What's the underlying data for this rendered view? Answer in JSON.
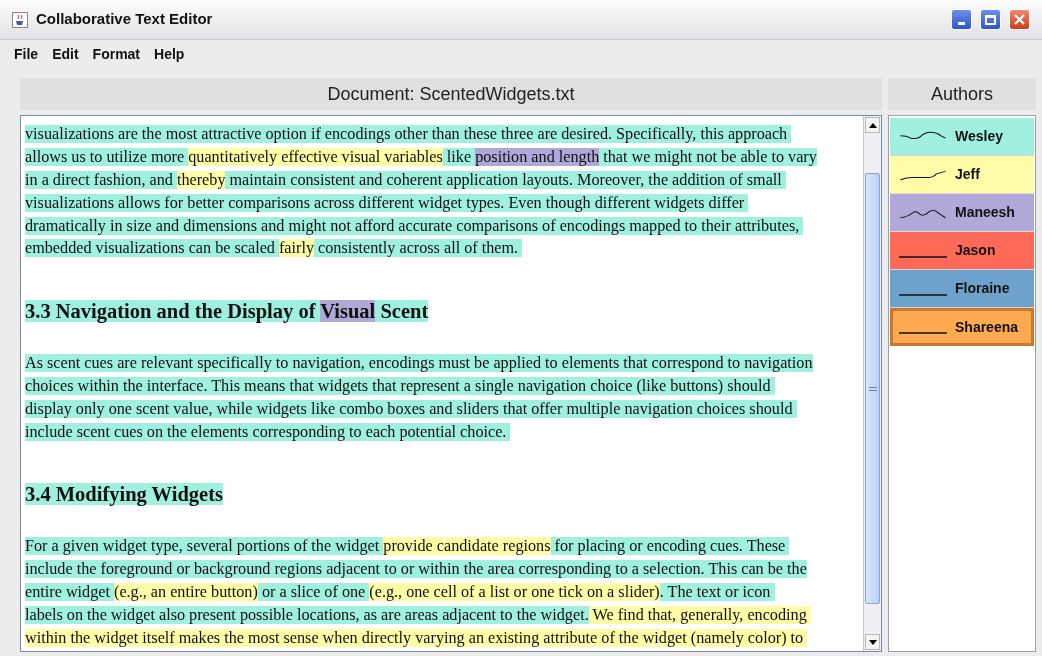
{
  "window": {
    "title": "Collaborative Text Editor"
  },
  "menu": [
    {
      "label": "File"
    },
    {
      "label": "Edit"
    },
    {
      "label": "Format"
    },
    {
      "label": "Help"
    }
  ],
  "document": {
    "title": "Document: ScentedWidgets.txt",
    "blocks": [
      {
        "kind": "paragraph",
        "lines": [
          {
            "segments": [
              {
                "text": "visualizations are the most attractive option if encodings other than these three are desired. Specifically, this approach ",
                "color": "#a0f0e0"
              }
            ]
          },
          {
            "segments": [
              {
                "text": "allows us to utilize more ",
                "color": "#a0f0e0"
              },
              {
                "text": "quantitatively effective visual variables",
                "color": "#fffca8"
              },
              {
                "text": " like ",
                "color": "#a0f0e0"
              },
              {
                "text": "position and length",
                "color": "#b0a8d8"
              },
              {
                "text": " that we might not be able to vary",
                "color": "#a0f0e0"
              }
            ]
          },
          {
            "segments": [
              {
                "text": "in a direct fashion, and ",
                "color": "#a0f0e0"
              },
              {
                "text": "thereby",
                "color": "#fffca8"
              },
              {
                "text": " maintain consistent and coherent application layouts. Moreover, the addition of small ",
                "color": "#a0f0e0"
              }
            ]
          },
          {
            "segments": [
              {
                "text": "visualizations allows for better comparisons across different widget types. Even though different widgets differ ",
                "color": "#a0f0e0"
              }
            ]
          },
          {
            "segments": [
              {
                "text": "dramatically in size and dimensions and might not afford accurate comparisons of encodings mapped to their attributes, ",
                "color": "#a0f0e0"
              }
            ]
          },
          {
            "segments": [
              {
                "text": "embedded visualizations can be scaled ",
                "color": "#a0f0e0"
              },
              {
                "text": "fairly",
                "color": "#fffca8"
              },
              {
                "text": " consistently across all of them. ",
                "color": "#a0f0e0"
              }
            ]
          }
        ]
      },
      {
        "kind": "heading",
        "lines": [
          {
            "segments": [
              {
                "text": "3.3 Navigation and the Display of ",
                "color": "#a0f0e0"
              },
              {
                "text": "Visual",
                "color": "#b0a8d8"
              },
              {
                "text": " Scent",
                "color": "#a0f0e0"
              }
            ]
          }
        ]
      },
      {
        "kind": "paragraph",
        "lines": [
          {
            "segments": [
              {
                "text": "As scent cues are relevant specifically to navigation, encodings must be applied to elements that correspond to navigation",
                "color": "#a0f0e0"
              }
            ]
          },
          {
            "segments": [
              {
                "text": "choices within the interface. This means that widgets that represent a single navigation choice (like buttons) should ",
                "color": "#a0f0e0"
              }
            ]
          },
          {
            "segments": [
              {
                "text": "display only one scent value, while widgets like combo boxes and sliders that offer multiple navigation choices should ",
                "color": "#a0f0e0"
              }
            ]
          },
          {
            "segments": [
              {
                "text": "include scent cues on the elements corresponding to each potential choice. ",
                "color": "#a0f0e0"
              }
            ]
          }
        ]
      },
      {
        "kind": "heading",
        "lines": [
          {
            "segments": [
              {
                "text": "3.4 Modifying Widgets",
                "color": "#a0f0e0"
              }
            ]
          }
        ]
      },
      {
        "kind": "paragraph",
        "lines": [
          {
            "segments": [
              {
                "text": "For a given widget type, several portions of the widget ",
                "color": "#a0f0e0"
              },
              {
                "text": "provide candidate regions",
                "color": "#fffca8"
              },
              {
                "text": " for placing or encoding cues. These ",
                "color": "#a0f0e0"
              }
            ]
          },
          {
            "segments": [
              {
                "text": "include the foreground or background regions adjacent to or within the area corresponding to a selection. This can be the",
                "color": "#a0f0e0"
              }
            ]
          },
          {
            "segments": [
              {
                "text": "entire widget ",
                "color": "#a0f0e0"
              },
              {
                "text": "(e.g., an entire button)",
                "color": "#fffca8"
              },
              {
                "text": " or a slice of one ",
                "color": "#a0f0e0"
              },
              {
                "text": "(e.g., one cell of a list or one tick on a slider)",
                "color": "#fffca8"
              },
              {
                "text": ". The text or icon ",
                "color": "#a0f0e0"
              }
            ]
          },
          {
            "segments": [
              {
                "text": "labels on the widget also present possible locations, as are areas adjacent to the widget.",
                "color": "#a0f0e0"
              },
              {
                "text": " We find that, generally, encoding ",
                "color": "#fffca8"
              }
            ]
          },
          {
            "segments": [
              {
                "text": "within the widget itself makes the most sense when directly varying an existing attribute of the widget (namely color) to ",
                "color": "#fffca8"
              }
            ]
          }
        ]
      }
    ]
  },
  "authors_panel": {
    "title": "Authors",
    "authors": [
      {
        "name": "Wesley",
        "color": "#a0f0e0",
        "selected": false,
        "kind": "wave"
      },
      {
        "name": "Jeff",
        "color": "#fffca8",
        "selected": false,
        "kind": "wave"
      },
      {
        "name": "Maneesh",
        "color": "#b0a8d8",
        "selected": false,
        "kind": "wave"
      },
      {
        "name": "Jason",
        "color": "#ff6a58",
        "selected": false,
        "kind": "flat"
      },
      {
        "name": "Floraine",
        "color": "#6ea2cc",
        "selected": false,
        "kind": "flat"
      },
      {
        "name": "Shareena",
        "color": "#ffaa50",
        "selected": true,
        "kind": "flat"
      }
    ]
  }
}
